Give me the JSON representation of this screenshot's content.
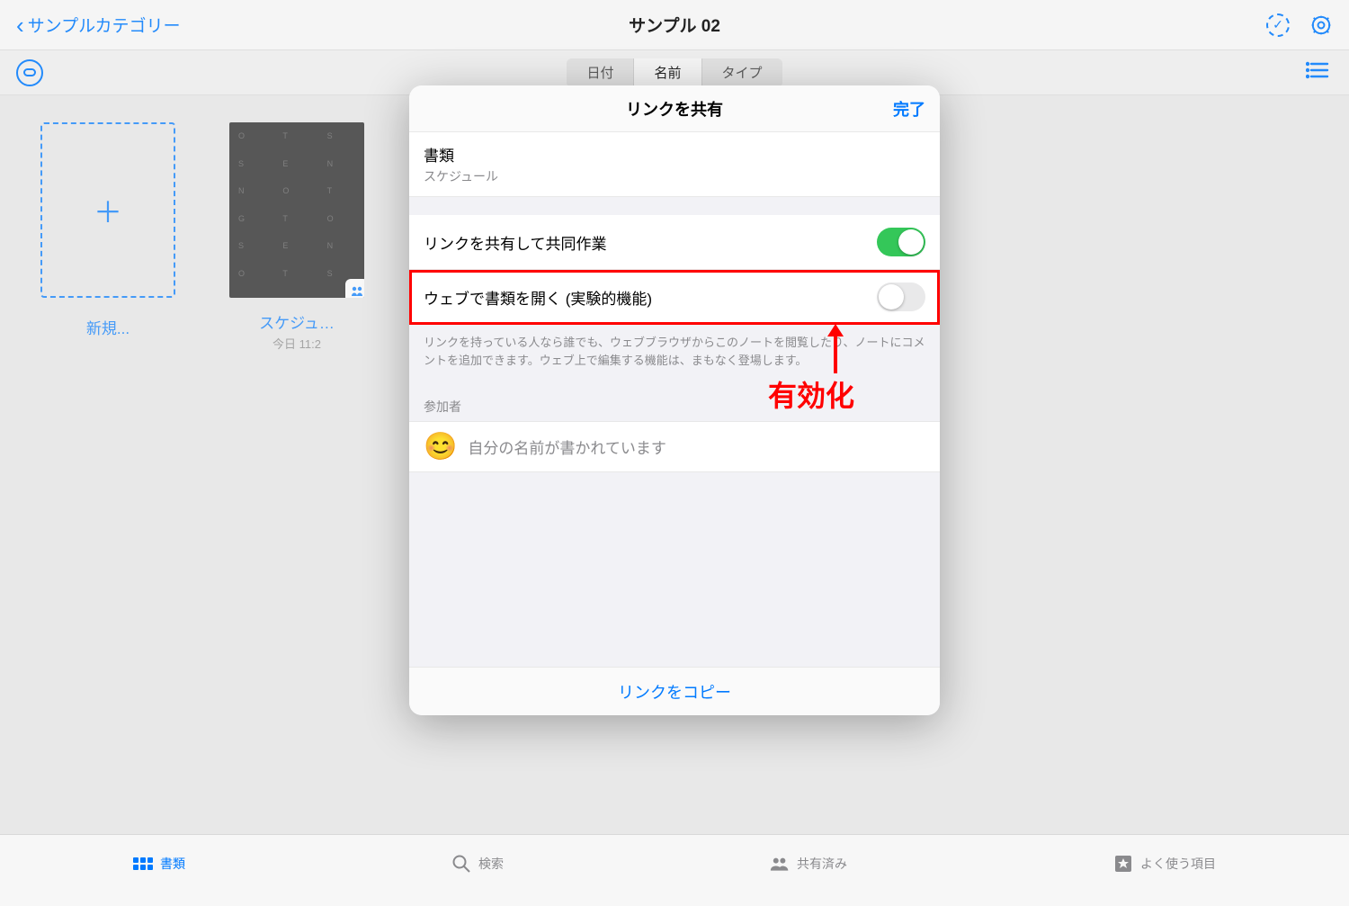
{
  "topbar": {
    "back_label": "サンプルカテゴリー",
    "title": "サンプル 02"
  },
  "segmented": {
    "items": [
      "日付",
      "名前",
      "タイプ"
    ],
    "active_index": 1
  },
  "grid": {
    "new_label": "新規...",
    "doc": {
      "name": "スケジュ…",
      "date": "今日 11:2"
    }
  },
  "modal": {
    "title": "リンクを共有",
    "done_label": "完了",
    "document_section": {
      "label": "書類",
      "sublabel": "スケジュール"
    },
    "share_row": {
      "label": "リンクを共有して共同作業",
      "on": true
    },
    "web_row": {
      "label": "ウェブで書類を開く (実験的機能)",
      "on": false
    },
    "web_description": "リンクを持っている人なら誰でも、ウェブブラウザからこのノートを閲覧したり、ノートにコメントを追加できます。ウェブ上で編集する機能は、まもなく登場します。",
    "participants_header": "参加者",
    "participant_placeholder": "自分の名前が書かれています",
    "copy_link_label": "リンクをコピー"
  },
  "annotation": {
    "label": "有効化"
  },
  "tabbar": {
    "items": [
      {
        "label": "書類",
        "icon": "grid"
      },
      {
        "label": "検索",
        "icon": "search"
      },
      {
        "label": "共有済み",
        "icon": "people"
      },
      {
        "label": "よく使う項目",
        "icon": "star"
      }
    ],
    "active_index": 0
  }
}
